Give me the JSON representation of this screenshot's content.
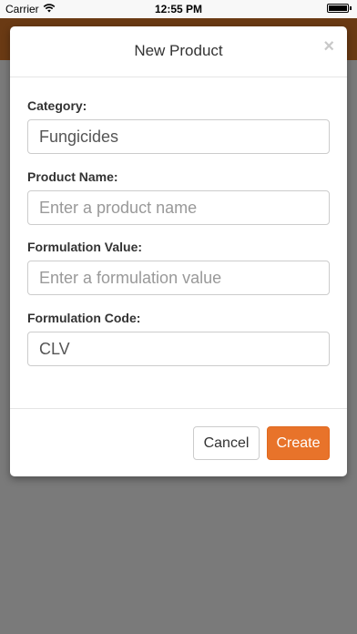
{
  "status_bar": {
    "carrier": "Carrier",
    "time": "12:55 PM",
    "icons": {
      "wifi": "wifi-icon",
      "battery": "battery-icon"
    }
  },
  "modal": {
    "title": "New Product",
    "close_glyph": "×",
    "fields": {
      "category": {
        "label": "Category:",
        "value": "Fungicides",
        "placeholder": ""
      },
      "product_name": {
        "label": "Product Name:",
        "value": "",
        "placeholder": "Enter a product name"
      },
      "formulation_value": {
        "label": "Formulation Value:",
        "value": "",
        "placeholder": "Enter a formulation value"
      },
      "formulation_code": {
        "label": "Formulation Code:",
        "value": "CLV",
        "placeholder": ""
      }
    },
    "buttons": {
      "cancel": "Cancel",
      "create": "Create"
    }
  },
  "colors": {
    "accent": "#e8732a",
    "app_header": "#6a3a14",
    "backdrop": "#7a7a7a"
  }
}
